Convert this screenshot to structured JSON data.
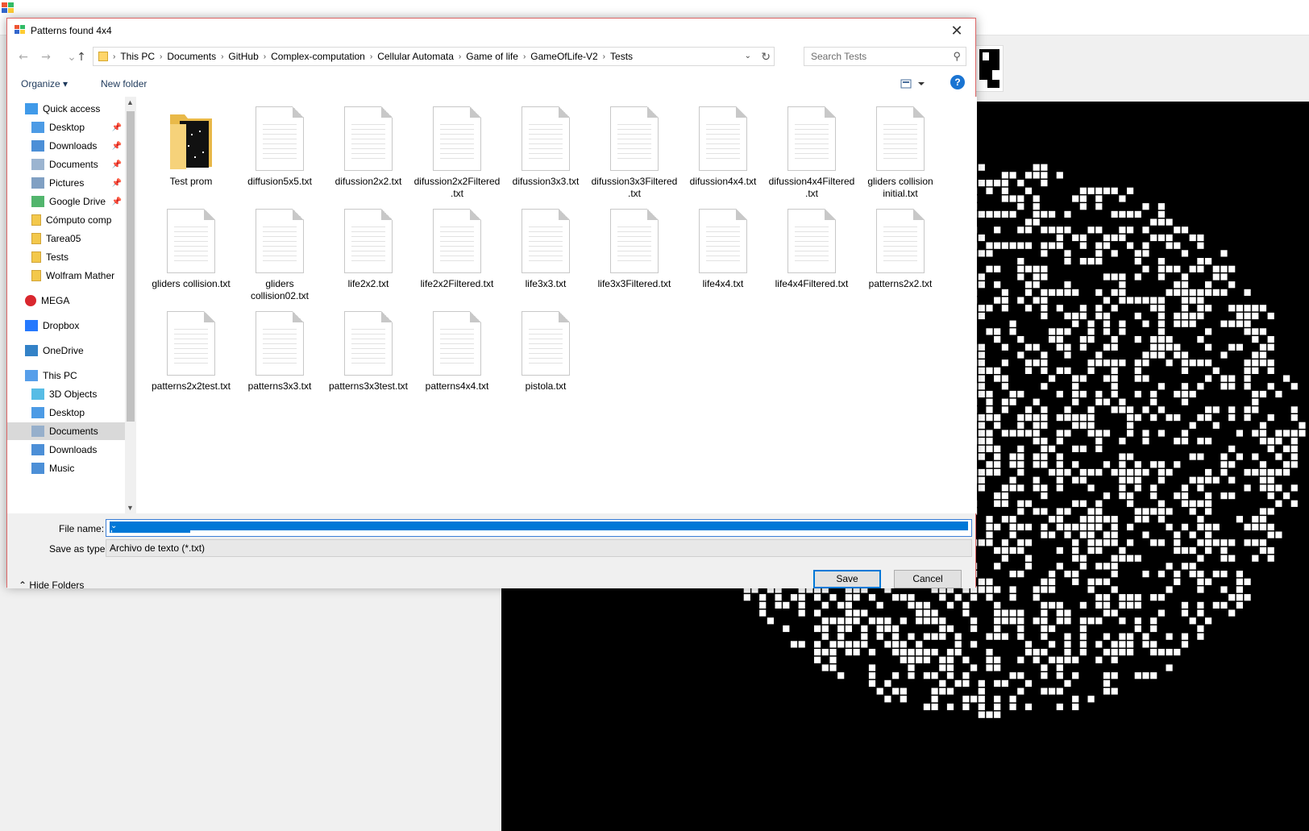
{
  "dialog": {
    "title": "Patterns found 4x4",
    "close_label": "✕"
  },
  "address": {
    "crumbs": [
      "This PC",
      "Documents",
      "GitHub",
      "Complex-computation",
      "Cellular Automata",
      "Game of life",
      "GameOfLife-V2",
      "Tests"
    ],
    "separator": "›",
    "search_placeholder": "Search Tests"
  },
  "toolbar": {
    "organize": "Organize ▾",
    "new_folder": "New folder",
    "help": "?"
  },
  "nav": {
    "items": [
      {
        "label": "Quick access",
        "icon": "star-icon"
      },
      {
        "label": "Desktop",
        "icon": "desktop-icon",
        "pinned": true
      },
      {
        "label": "Downloads",
        "icon": "download-icon",
        "pinned": true
      },
      {
        "label": "Documents",
        "icon": "documents-icon",
        "pinned": true
      },
      {
        "label": "Pictures",
        "icon": "pictures-icon",
        "pinned": true
      },
      {
        "label": "Google Drive",
        "icon": "google-drive-icon",
        "pinned": true
      },
      {
        "label": "Cómputo comp",
        "icon": "folder-icon"
      },
      {
        "label": "Tarea05",
        "icon": "folder-icon"
      },
      {
        "label": "Tests",
        "icon": "folder-icon"
      },
      {
        "label": "Wolfram Mather",
        "icon": "folder-icon"
      },
      {
        "label": "MEGA",
        "icon": "mega-icon"
      },
      {
        "label": "Dropbox",
        "icon": "dropbox-icon"
      },
      {
        "label": "OneDrive",
        "icon": "onedrive-icon"
      },
      {
        "label": "This PC",
        "icon": "pc-icon"
      },
      {
        "label": "3D Objects",
        "icon": "3d-objects-icon"
      },
      {
        "label": "Desktop",
        "icon": "desktop-icon"
      },
      {
        "label": "Documents",
        "icon": "documents-icon",
        "selected": true
      },
      {
        "label": "Downloads",
        "icon": "download-icon"
      },
      {
        "label": "Music",
        "icon": "music-icon"
      }
    ]
  },
  "files": [
    {
      "name": "Test prom",
      "type": "folder"
    },
    {
      "name": "diffusion5x5.txt"
    },
    {
      "name": "difussion2x2.txt"
    },
    {
      "name": "difussion2x2Filtered.txt"
    },
    {
      "name": "difussion3x3.txt"
    },
    {
      "name": "difussion3x3Filtered.txt"
    },
    {
      "name": "difussion4x4.txt"
    },
    {
      "name": "difussion4x4Filtered.txt"
    },
    {
      "name": "gliders collision initial.txt"
    },
    {
      "name": "gliders collision.txt"
    },
    {
      "name": "gliders collision02.txt"
    },
    {
      "name": "life2x2.txt"
    },
    {
      "name": "life2x2Filtered.txt"
    },
    {
      "name": "life3x3.txt"
    },
    {
      "name": "life3x3Filtered.txt"
    },
    {
      "name": "life4x4.txt"
    },
    {
      "name": "life4x4Filtered.txt"
    },
    {
      "name": "patterns2x2.txt"
    },
    {
      "name": "patterns2x2test.txt"
    },
    {
      "name": "patterns3x3.txt"
    },
    {
      "name": "patterns3x3test.txt"
    },
    {
      "name": "patterns4x4.txt"
    },
    {
      "name": "pistola.txt"
    }
  ],
  "form": {
    "file_name_label": "File name:",
    "file_name_value": "patterns4x4test.txt",
    "save_type_label": "Save as type:",
    "save_type_value": "Archivo de texto (*.txt)",
    "hide_folders": "Hide Folders",
    "save": "Save",
    "cancel": "Cancel"
  }
}
